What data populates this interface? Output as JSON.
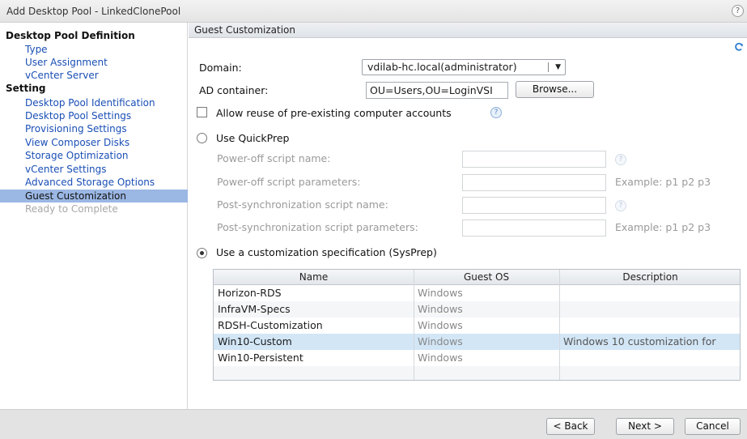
{
  "window": {
    "title": "Add Desktop Pool - LinkedClonePool",
    "help_glyph": "?"
  },
  "sidebar": {
    "sections": [
      {
        "label": "Desktop Pool Definition"
      },
      {
        "label": "Setting"
      }
    ],
    "items": [
      {
        "label": "Type"
      },
      {
        "label": "User Assignment"
      },
      {
        "label": "vCenter Server"
      },
      {
        "label": "Desktop Pool Identification"
      },
      {
        "label": "Desktop Pool Settings"
      },
      {
        "label": "Provisioning Settings"
      },
      {
        "label": "View Composer Disks"
      },
      {
        "label": "Storage Optimization"
      },
      {
        "label": "vCenter Settings"
      },
      {
        "label": "Advanced Storage Options"
      },
      {
        "label": "Guest Customization"
      },
      {
        "label": "Ready to Complete"
      }
    ]
  },
  "main": {
    "header": "Guest Customization",
    "domain": {
      "label": "Domain:",
      "value": "vdilab-hc.local(administrator)"
    },
    "ad_container": {
      "label": "AD container:",
      "value": "OU=Users,OU=LoginVSI",
      "browse_label": "Browse..."
    },
    "reuse_accounts": {
      "label": "Allow reuse of pre-existing computer accounts",
      "checked": false
    },
    "quickprep": {
      "label": "Use QuickPrep",
      "selected": false,
      "fields": [
        {
          "label": "Power-off script name:",
          "hint": ""
        },
        {
          "label": "Power-off script parameters:",
          "hint": "Example: p1 p2 p3"
        },
        {
          "label": "Post-synchronization script name:",
          "hint": ""
        },
        {
          "label": "Post-synchronization script parameters:",
          "hint": "Example: p1 p2 p3"
        }
      ]
    },
    "sysprep": {
      "label": "Use a customization specification (SysPrep)",
      "selected": true,
      "columns": [
        "Name",
        "Guest OS",
        "Description"
      ],
      "rows": [
        {
          "name": "Horizon-RDS",
          "os": "Windows",
          "description": ""
        },
        {
          "name": "InfraVM-Specs",
          "os": "Windows",
          "description": ""
        },
        {
          "name": "RDSH-Customization",
          "os": "Windows",
          "description": ""
        },
        {
          "name": "Win10-Custom",
          "os": "Windows",
          "description": "Windows 10 customization for"
        },
        {
          "name": "Win10-Persistent",
          "os": "Windows",
          "description": ""
        }
      ]
    }
  },
  "footer": {
    "back_label": "< Back",
    "next_label": "Next >",
    "cancel_label": "Cancel"
  },
  "colors": {
    "selected_nav": "#9bb7e4",
    "link": "#1a4fb5",
    "selected_row": "#d2e6f6"
  }
}
